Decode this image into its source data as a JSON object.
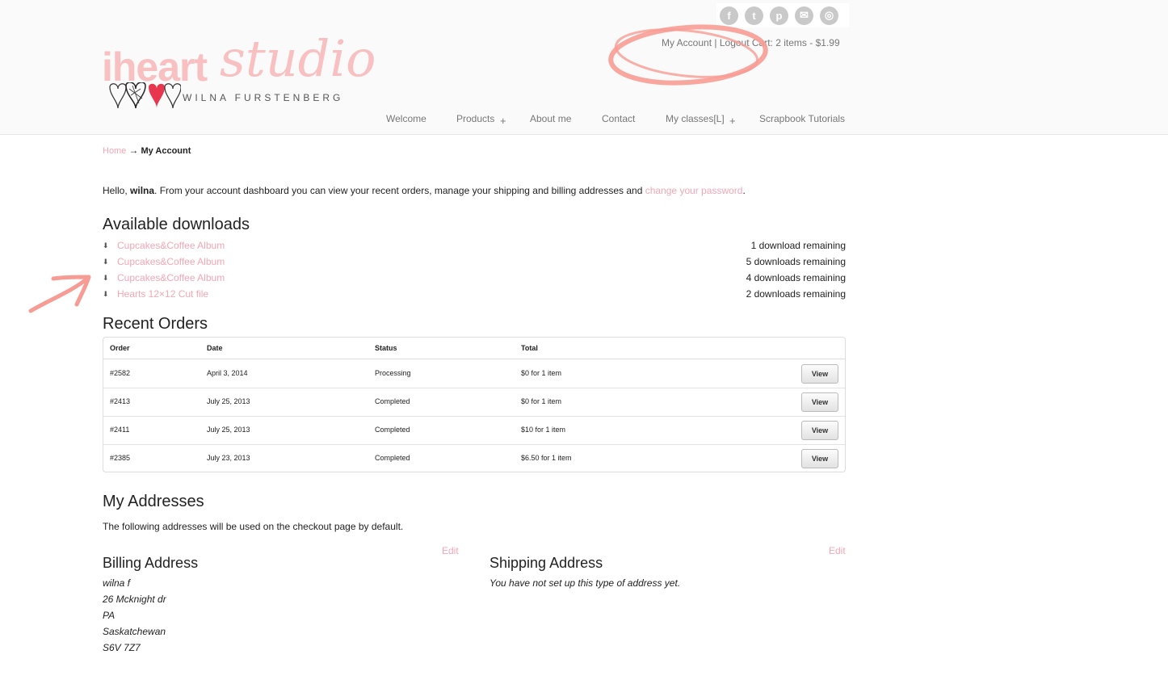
{
  "logo": {
    "text_main": "iheart",
    "text_script": "studio",
    "subtitle": "WILNA FURSTENBERG"
  },
  "social_icons": [
    "facebook-icon",
    "twitter-icon",
    "pinterest-icon",
    "email-icon",
    "instagram-icon"
  ],
  "social_glyphs": [
    "f",
    "t",
    "p",
    "✉",
    "◎"
  ],
  "account_bar": {
    "my_account": "My Account",
    "sep1": "|",
    "logout": "Logout",
    "cart_prefix": "Cart:",
    "cart_items": "2 items",
    "cart_sep": "-",
    "cart_total": "$1.99"
  },
  "nav": {
    "welcome": "Welcome",
    "products": "Products",
    "about": "About me",
    "contact": "Contact",
    "classes": "My classes[L]",
    "tutorials": "Scrapbook Tutorials",
    "plus": "+"
  },
  "breadcrumb": {
    "home": "Home",
    "arrow": "→",
    "current": "My Account"
  },
  "greeting": {
    "hello": "Hello,",
    "user": "wilna",
    "text": ". From your account dashboard you can view your recent orders, manage your shipping and billing addresses and",
    "link": "change your password",
    "end": "."
  },
  "downloads": {
    "title": "Available downloads",
    "arrow": "⬇",
    "items": [
      {
        "name": "Cupcakes&Coffee Album",
        "remaining": "1 download remaining"
      },
      {
        "name": "Cupcakes&Coffee Album",
        "remaining": "5 downloads remaining"
      },
      {
        "name": "Cupcakes&Coffee Album",
        "remaining": "4 downloads remaining"
      },
      {
        "name": "Hearts 12×12 Cut file",
        "remaining": "2 downloads remaining"
      }
    ]
  },
  "orders": {
    "title": "Recent Orders",
    "headers": {
      "order": "Order",
      "date": "Date",
      "status": "Status",
      "total": "Total"
    },
    "view_label": "View",
    "rows": [
      {
        "order": "#2582",
        "date": "April 3, 2014",
        "status": "Processing",
        "total": "$0 for 1 item"
      },
      {
        "order": "#2413",
        "date": "July 25, 2013",
        "status": "Completed",
        "total": "$0 for 1 item"
      },
      {
        "order": "#2411",
        "date": "July 25, 2013",
        "status": "Completed",
        "total": "$10 for 1 item"
      },
      {
        "order": "#2385",
        "date": "July 23, 2013",
        "status": "Completed",
        "total": "$6.50 for 1 item"
      }
    ]
  },
  "addresses": {
    "title": "My Addresses",
    "intro": "The following addresses will be used on the checkout page by default.",
    "edit_label": "Edit",
    "billing": {
      "title": "Billing Address",
      "lines": [
        "wilna f",
        "26 Mcknight dr",
        "PA",
        "Saskatchewan",
        "S6V 7Z7"
      ]
    },
    "shipping": {
      "title": "Shipping Address",
      "empty": "You have not set up this type of address yet."
    }
  },
  "colors": {
    "link_pink": "#f5a6b6",
    "annotation": "#f79c94"
  }
}
